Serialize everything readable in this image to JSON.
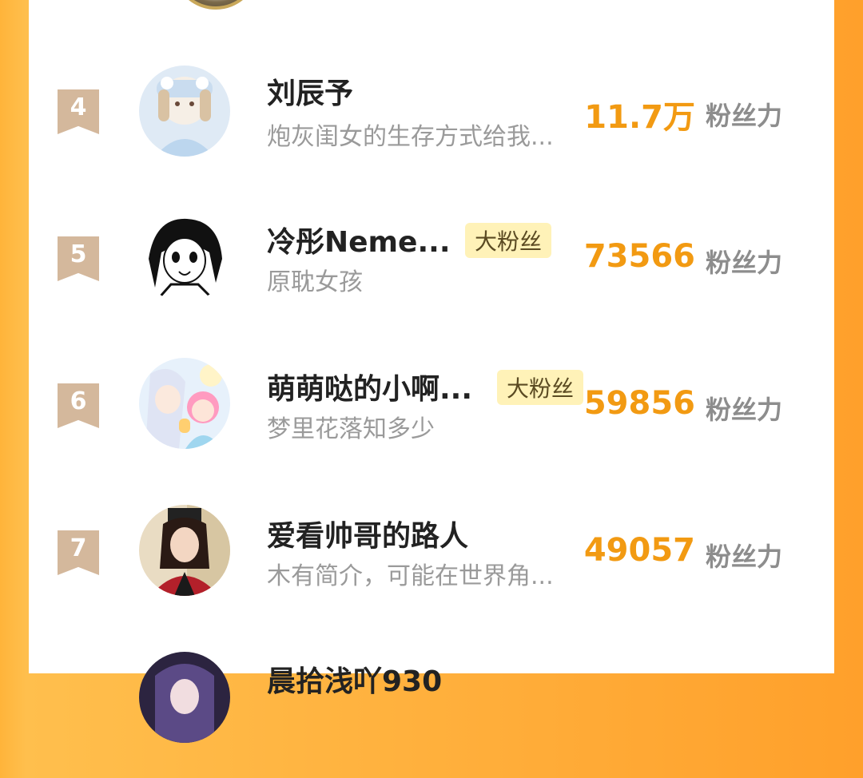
{
  "score_label": "粉丝力",
  "colors": {
    "accent": "#f29a12",
    "badge_bg": "#fff2b8",
    "rank_ribbon": "#d4b89c"
  },
  "rows": [
    {
      "rank": "4",
      "name": "刘辰予",
      "badge": "",
      "desc": "炮灰闺女的生存方式给我...",
      "score": "11.7万"
    },
    {
      "rank": "5",
      "name": "冷彤Neme...",
      "badge": "大粉丝",
      "desc": "原耽女孩",
      "score": "73566"
    },
    {
      "rank": "6",
      "name": "萌萌哒的小啊...",
      "badge": "大粉丝",
      "desc": "梦里花落知多少",
      "score": "59856"
    },
    {
      "rank": "7",
      "name": "爱看帅哥的路人",
      "badge": "",
      "desc": "木有简介，可能在世界角...",
      "score": "49057"
    },
    {
      "rank": "",
      "name": "晨拾浅吖930",
      "badge": "",
      "desc": "",
      "score": ""
    }
  ]
}
